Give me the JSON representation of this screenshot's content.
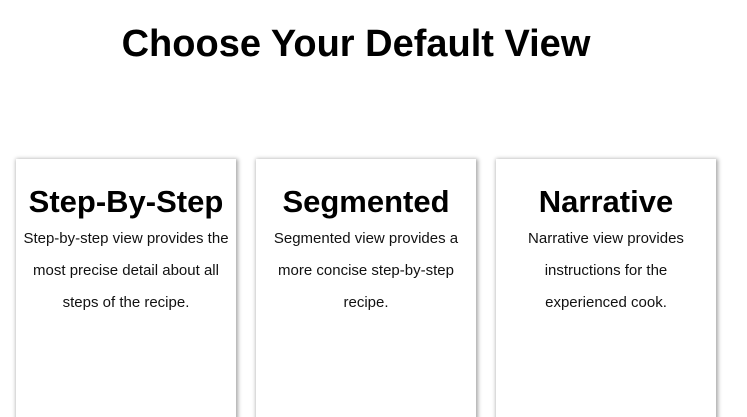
{
  "page": {
    "title": "Choose Your Default View"
  },
  "views": [
    {
      "title": "Step-By-Step",
      "description": "Step-by-step view provides the most precise detail about all steps of the recipe."
    },
    {
      "title": "Segmented",
      "description": "Segmented view provides a more concise step-by-step recipe."
    },
    {
      "title": "Narrative",
      "description": "Narrative view provides instructions for the experienced cook."
    }
  ]
}
